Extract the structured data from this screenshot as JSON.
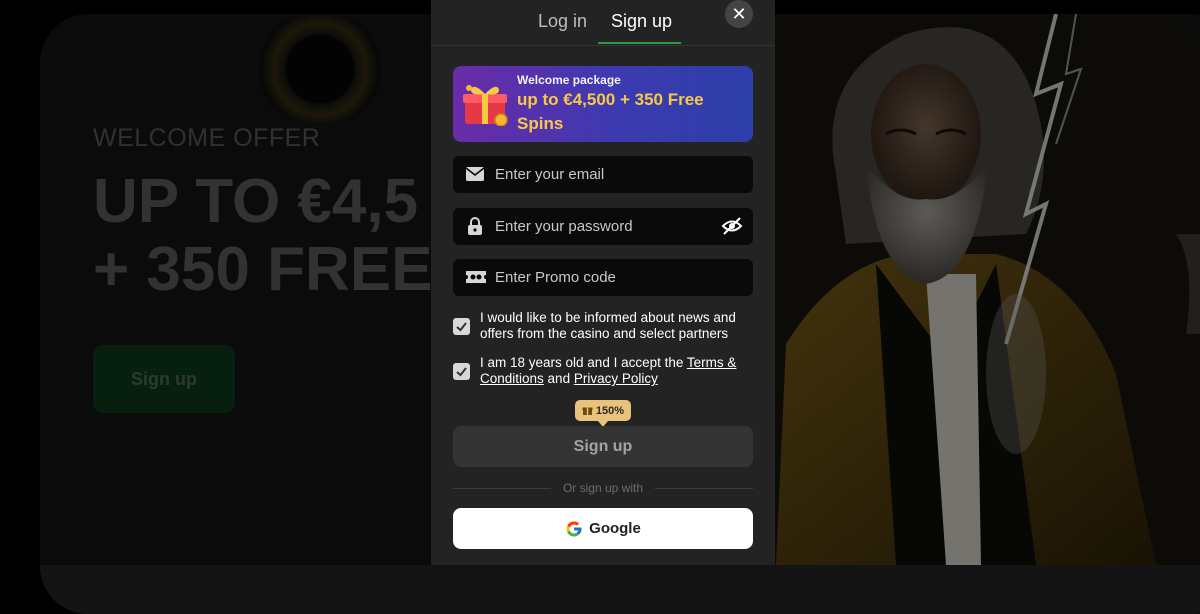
{
  "background": {
    "offer_label": "WELCOME OFFER",
    "headline_line1": "UP TO €4,5",
    "headline_line2": "+ 350 FREE",
    "signup_button": "Sign up"
  },
  "modal": {
    "tabs": [
      {
        "label": "Log in",
        "active": false
      },
      {
        "label": "Sign up",
        "active": true
      }
    ],
    "close_icon": "close-icon",
    "promo": {
      "title": "Welcome package",
      "offer": "up to €4,500 + 350 Free Spins",
      "icon": "gift-icon"
    },
    "fields": {
      "email": {
        "placeholder": "Enter your email",
        "value": "",
        "icon": "mail-icon"
      },
      "password": {
        "placeholder": "Enter your password",
        "value": "",
        "icon": "lock-icon",
        "toggle_icon": "eye-off-icon"
      },
      "promo_code": {
        "placeholder": "Enter Promo code",
        "value": "",
        "icon": "promo-ticket-icon"
      }
    },
    "checkboxes": {
      "news": {
        "checked": true,
        "text": "I would like to be informed about news and offers from the casino and select partners"
      },
      "age": {
        "checked": true,
        "text_prefix": "I am 18 years old and I accept the ",
        "terms_link": "Terms & Conditions",
        "middle": " and ",
        "privacy_link": "Privacy Policy"
      }
    },
    "bonus_badge": "150%",
    "submit_label": "Sign up",
    "divider_text": "Or sign up with",
    "google_label": "Google"
  },
  "colors": {
    "accent_green": "#2a9a4a",
    "promo_gold": "#f7c948",
    "badge_gold": "#e9c37b",
    "modal_bg": "#232323"
  }
}
